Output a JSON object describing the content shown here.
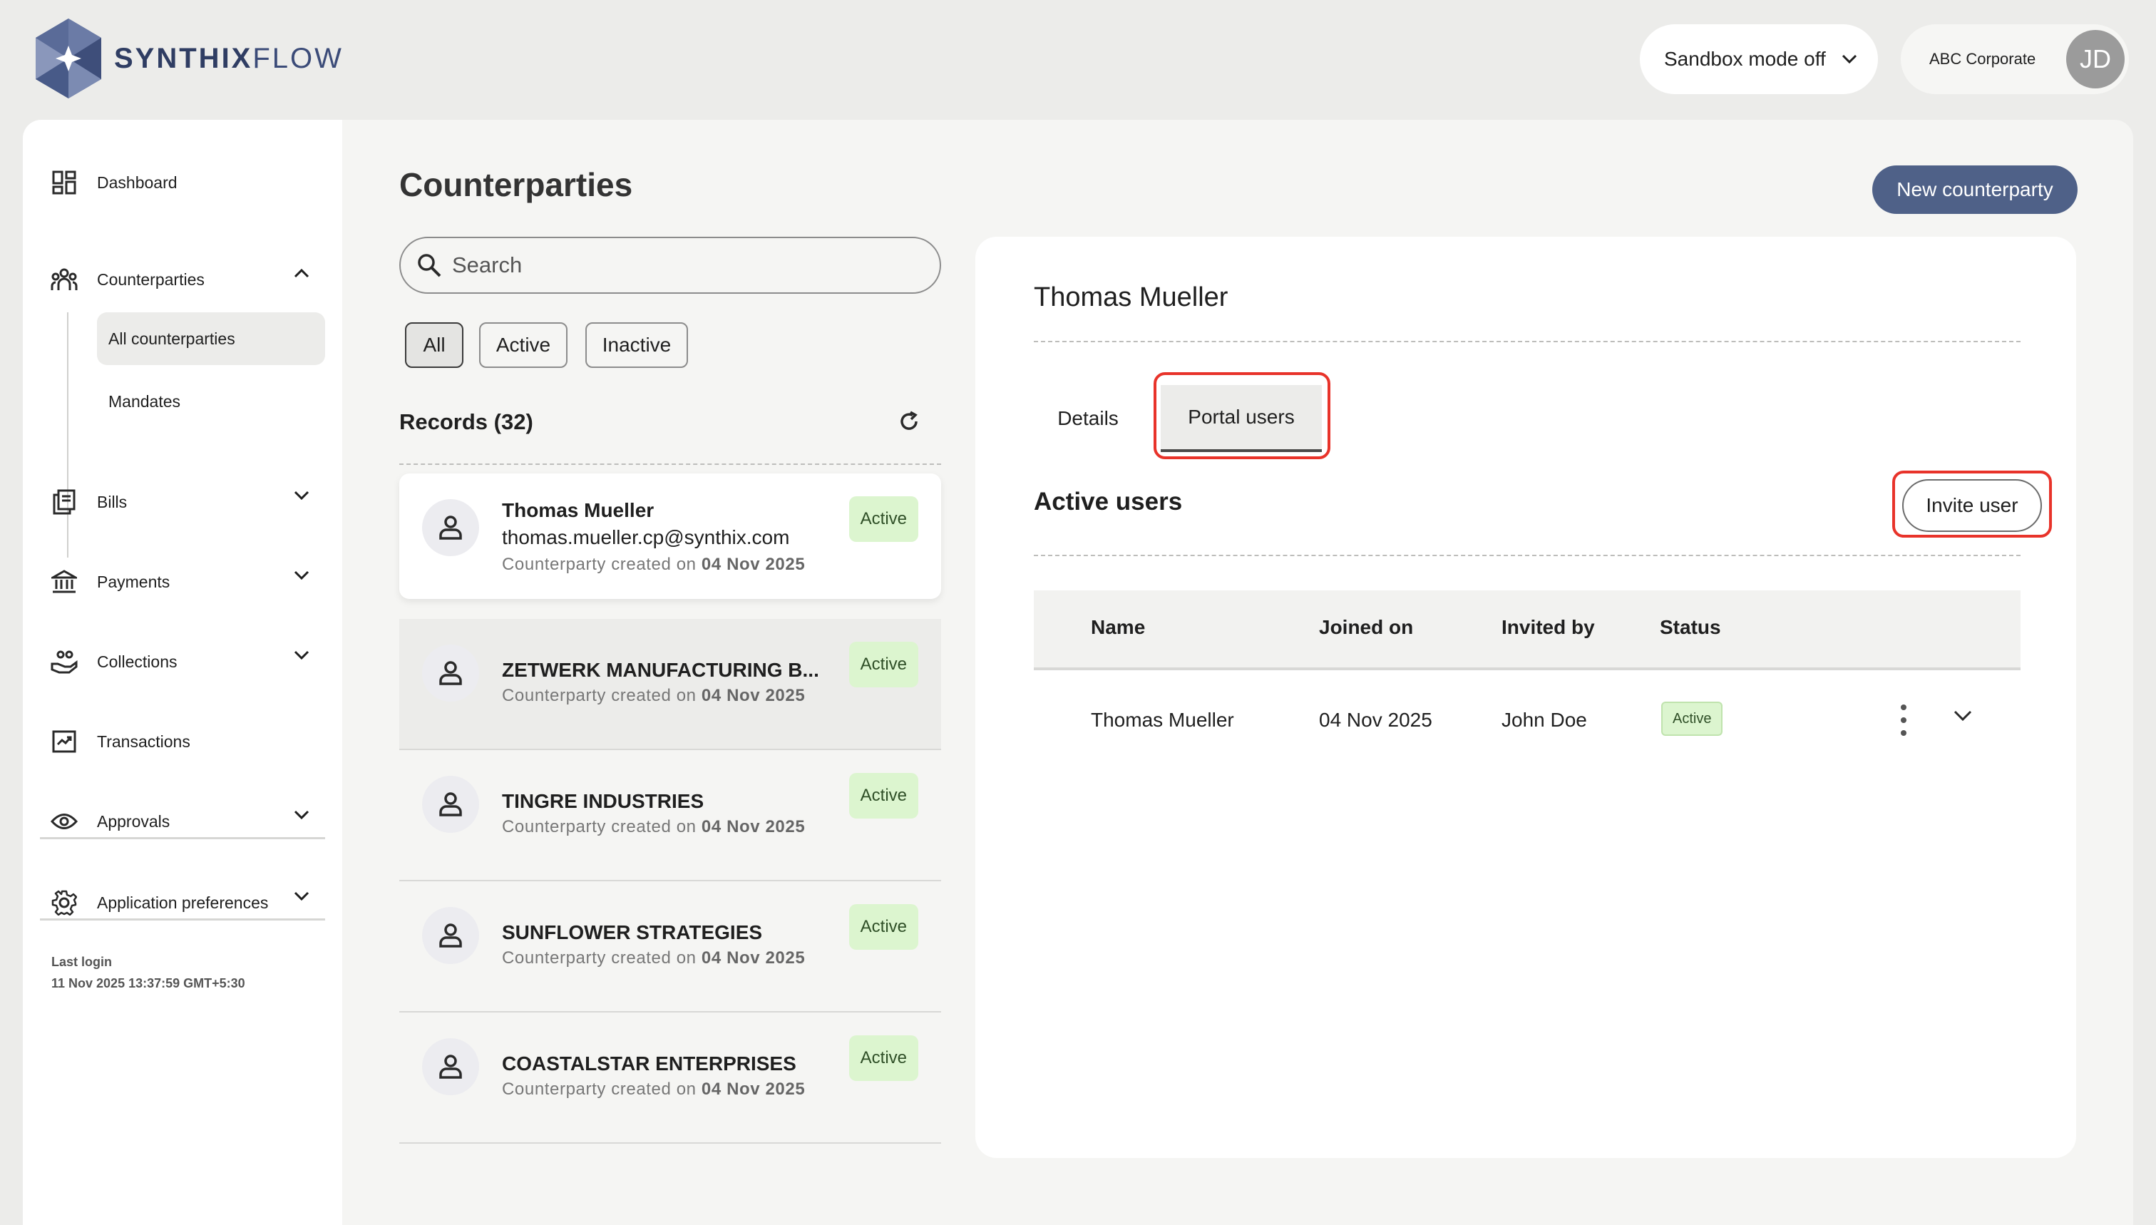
{
  "brand": {
    "name_bold": "SYNTHIX",
    "name_light": "FLOW"
  },
  "topbar": {
    "sandbox_label": "Sandbox mode off",
    "org_name": "ABC Corporate",
    "avatar_initials": "JD"
  },
  "sidebar": {
    "dashboard": "Dashboard",
    "counterparties": "Counterparties",
    "sub_all": "All counterparties",
    "sub_mandates": "Mandates",
    "bills": "Bills",
    "payments": "Payments",
    "collections": "Collections",
    "transactions": "Transactions",
    "approvals": "Approvals",
    "app_prefs": "Application preferences",
    "last_login_label": "Last login",
    "last_login_value": "11 Nov 2025 13:37:59 GMT+5:30"
  },
  "page": {
    "title": "Counterparties",
    "new_button": "New counterparty",
    "search_placeholder": "Search",
    "filters": [
      "All",
      "Active",
      "Inactive"
    ],
    "records_label": "Records (32)"
  },
  "records": [
    {
      "name": "Thomas Mueller",
      "email": "thomas.mueller.cp@synthix.com",
      "meta_prefix": "Counterparty created on",
      "date": "04 Nov 2025",
      "status": "Active"
    },
    {
      "name": "ZETWERK MANUFACTURING B...",
      "meta_prefix": "Counterparty created on",
      "date": "04 Nov 2025",
      "status": "Active"
    },
    {
      "name": "TINGRE INDUSTRIES",
      "meta_prefix": "Counterparty created on",
      "date": "04 Nov 2025",
      "status": "Active"
    },
    {
      "name": "SUNFLOWER STRATEGIES",
      "meta_prefix": "Counterparty created on",
      "date": "04 Nov 2025",
      "status": "Active"
    },
    {
      "name": "COASTALSTAR ENTERPRISES",
      "meta_prefix": "Counterparty created on",
      "date": "04 Nov 2025",
      "status": "Active"
    }
  ],
  "detail": {
    "name": "Thomas Mueller",
    "tabs": [
      "Details",
      "Portal users"
    ],
    "active_users_title": "Active users",
    "invite_button": "Invite user",
    "columns": [
      "Name",
      "Joined on",
      "Invited by",
      "Status"
    ],
    "users": [
      {
        "name": "Thomas Mueller",
        "joined": "04 Nov 2025",
        "invited_by": "John Doe",
        "status": "Active"
      }
    ]
  },
  "colors": {
    "accent": "#4f6188",
    "highlight_red": "#e8332a",
    "active_badge_bg": "#dcf5cf",
    "brand_text": "#2f3d63"
  }
}
